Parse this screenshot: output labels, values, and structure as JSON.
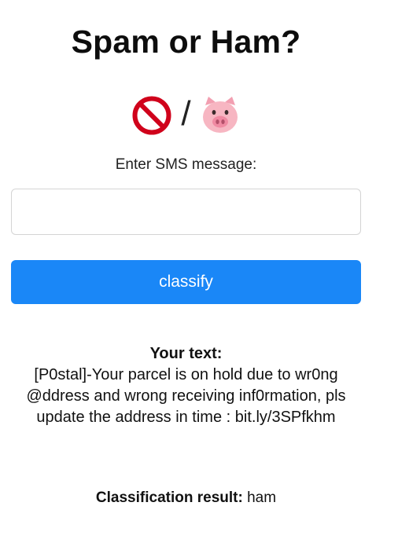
{
  "title": "Spam or Ham?",
  "emoji_row": {
    "left_icon": "prohibited-icon",
    "separator": "/",
    "right_icon": "pig-face-icon"
  },
  "prompt_label": "Enter SMS message:",
  "sms_input": {
    "value": "",
    "placeholder": ""
  },
  "classify_button_label": "classify",
  "result": {
    "heading": "Your text:",
    "body": "[P0stal]-Your parcel is on hold due to wr0ng @ddress and wrong receiving inf0rmation, pls update the address in time : bit.ly/3SPfkhm"
  },
  "classification": {
    "label": "Classification result:",
    "value": "ham"
  },
  "colors": {
    "button_bg": "#1a87f7",
    "button_text": "#ffffff",
    "prohibited_red": "#d0021b",
    "pig_pink": "#f7b6c2"
  }
}
